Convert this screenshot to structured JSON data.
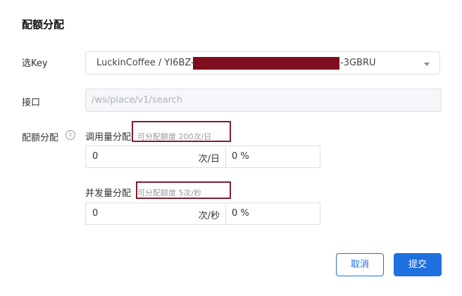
{
  "dialog": {
    "title": "配额分配"
  },
  "form": {
    "key_label": "选Key",
    "key_value_prefix": "LuckinCoffee / YI6BZ-",
    "key_value_suffix": "-3GBRU",
    "interface_label": "接口",
    "interface_placeholder": "/ws/place/v1/search",
    "quota_label": "配额分配",
    "call_quota": {
      "label": "调用量分配",
      "hint": "可分配额度 200次/日",
      "value": "0",
      "unit": "次/日",
      "percent": "0 %"
    },
    "concurrent_quota": {
      "label": "并发量分配",
      "hint": "可分配额度 5次/秒",
      "value": "0",
      "unit": "次/秒",
      "percent": "0 %"
    }
  },
  "buttons": {
    "cancel": "取消",
    "submit": "提交"
  },
  "colors": {
    "primary": "#1e6fe0",
    "redaction": "#7f0f1f",
    "highlight_border": "#7f1e2a"
  },
  "icons": {
    "dropdown": "chevron-down-icon",
    "info": "info-icon"
  }
}
